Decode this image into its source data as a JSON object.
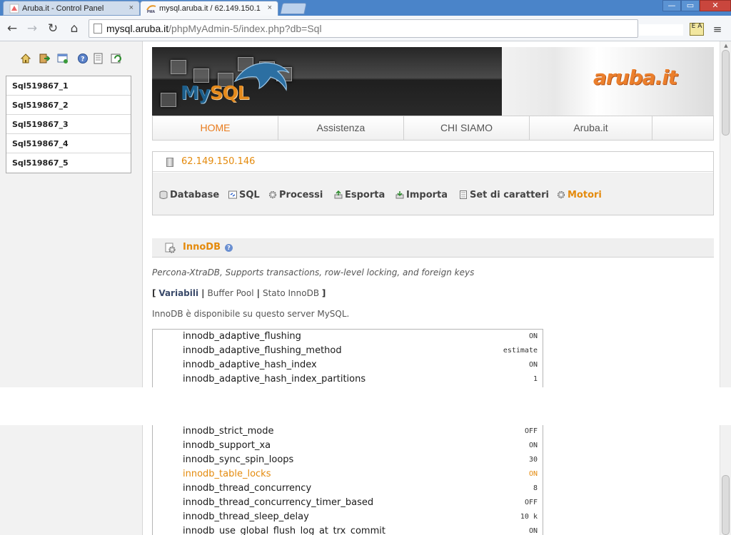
{
  "browser": {
    "tabs": [
      {
        "title": "Aruba.it - Control Panel",
        "close": "×"
      },
      {
        "title": "mysql.aruba.it / 62.149.150.1",
        "close": "×"
      }
    ],
    "window_controls": {
      "minimize": "—",
      "maximize": "▭",
      "close": "✕"
    },
    "url_host": "mysql.aruba.it",
    "url_path": "/phpMyAdmin-5/index.php?db=Sql",
    "ext_label": "E A"
  },
  "left": {
    "databases": [
      "Sql519867_1",
      "Sql519867_2",
      "Sql519867_3",
      "Sql519867_4",
      "Sql519867_5"
    ]
  },
  "banner": {
    "mysql_logo_part1": "My",
    "mysql_logo_part2": "SQL",
    "aruba_logo": "aruba.it"
  },
  "menu": {
    "items": [
      "HOME",
      "Assistenza",
      "CHI SIAMO",
      "Aruba.it"
    ],
    "active": "HOME"
  },
  "server": {
    "ip": "62.149.150.146",
    "tabs": [
      "Database",
      "SQL",
      "Processi",
      "Esporta",
      "Importa",
      "Set di caratteri",
      "Motori"
    ],
    "active_tab": "Motori"
  },
  "engine": {
    "name": "InnoDB",
    "description": "Percona-XtraDB, Supports transactions, row-level locking, and foreign keys",
    "subnav": {
      "open": "[",
      "close": "]",
      "sep": "|",
      "items": [
        "Variabili",
        "Buffer Pool",
        "Stato InnoDB"
      ]
    },
    "available_text": "InnoDB è disponibile su questo server MySQL."
  },
  "variables_top": [
    {
      "name": "innodb_adaptive_flushing",
      "value": "ON"
    },
    {
      "name": "innodb_adaptive_flushing_method",
      "value": "estimate"
    },
    {
      "name": "innodb_adaptive_hash_index",
      "value": "ON"
    },
    {
      "name": "innodb_adaptive_hash_index_partitions",
      "value": "1"
    }
  ],
  "variables_bottom": [
    {
      "name": "innodb_strict_mode",
      "value": "OFF"
    },
    {
      "name": "innodb_support_xa",
      "value": "ON"
    },
    {
      "name": "innodb_sync_spin_loops",
      "value": "30"
    },
    {
      "name": "innodb_table_locks",
      "value": "ON",
      "highlight": true
    },
    {
      "name": "innodb_thread_concurrency",
      "value": "8"
    },
    {
      "name": "innodb_thread_concurrency_timer_based",
      "value": "OFF"
    },
    {
      "name": "innodb_thread_sleep_delay",
      "value": "10 k"
    },
    {
      "name": "innodb_use_global_flush_log_at_trx_commit",
      "value": "ON"
    }
  ],
  "colors": {
    "accent_orange": "#e48a0c",
    "chrome_blue": "#4a84c9"
  },
  "icons": {
    "left_toolbar": [
      "home-icon",
      "exit-icon",
      "query-window-icon",
      "help-icon",
      "docs-icon",
      "reload-icon"
    ]
  }
}
